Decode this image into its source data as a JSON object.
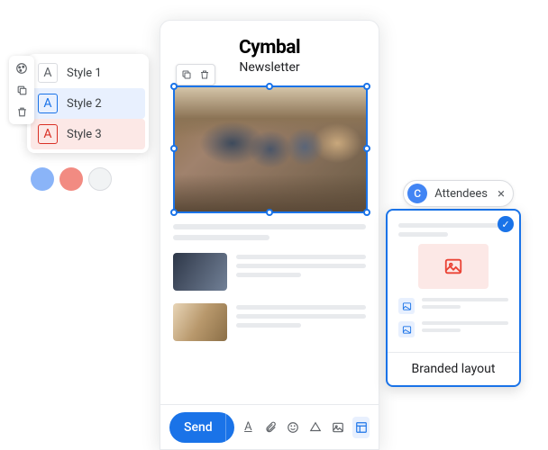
{
  "styleMenu": {
    "items": [
      {
        "label": "Style 1",
        "swatch": "A"
      },
      {
        "label": "Style 2",
        "swatch": "A"
      },
      {
        "label": "Style 3",
        "swatch": "A"
      }
    ]
  },
  "preview": {
    "brand": "Cymbal",
    "subtitle": "Newsletter"
  },
  "toolbar": {
    "send_label": "Send"
  },
  "chip": {
    "initial": "C",
    "label": "Attendees"
  },
  "layout": {
    "title": "Branded layout"
  }
}
